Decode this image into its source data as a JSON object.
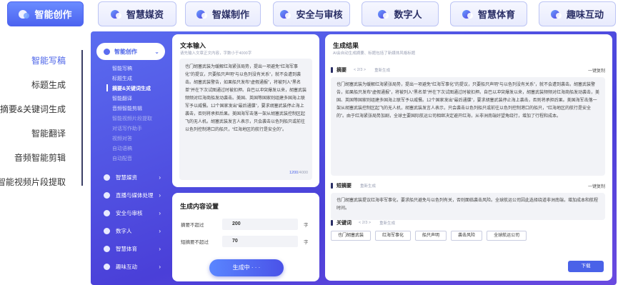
{
  "tabs": [
    {
      "label": "智能创作",
      "active": true
    },
    {
      "label": "智慧媒资"
    },
    {
      "label": "智媒制作"
    },
    {
      "label": "安全与审核"
    },
    {
      "label": "数字人"
    },
    {
      "label": "智慧体育"
    },
    {
      "label": "趣味互动"
    }
  ],
  "left_labels": [
    "智能写稿",
    "标题生成",
    "摘要&关键词生成",
    "智能翻译",
    "音频智能剪辑",
    "智能视频片段提取"
  ],
  "sidebar": {
    "head": "智能创作",
    "subs": [
      "智能写稿",
      "标题生成",
      "摘要&关键词生成",
      "智能翻译",
      "音频智能剪辑",
      "智能视频片段提取",
      "对话写作助手",
      "视频对答",
      "自动语稿",
      "自动配音"
    ],
    "items": [
      "智慧媒资",
      "直播与媒体处理",
      "安全与审核",
      "数字人",
      "智慧体育",
      "趣味互动"
    ]
  },
  "input_card": {
    "title": "文本输入",
    "hint": "请先输入文章正文内容，字数小于4000字",
    "text": "也门胡塞武装为缓解红海紧张局势，提出一项避免“红海军事化”的提议，只要船只声明“与以色列没有关系”，就不会遭到袭击。胡塞武装警告，如果船只发布“虚假通报”，将被列入“黑名单”并在下次试图通过时被扣押。自巴以冲突爆发以来，胡塞武装频频对红海商船发动袭击。美国、英国等国家则组建多国海上联军予以威慑。12个国家发出“最后通牒”，要求胡塞武装停止海上袭击，否则将承担后果。美国海军击落一架从胡塞武装控制区起飞的无人机。胡塞武装发言人表示，只会袭击以色列船只或前往以色列控制港口的船只，“红海地区的航行是安全的”。",
    "count_current": "1200",
    "count_max": "/4000"
  },
  "settings_card": {
    "title": "生成内容设置",
    "rows": [
      {
        "label": "摘要不超过",
        "value": "200",
        "unit": "字"
      },
      {
        "label": "短摘要不超过",
        "value": "70",
        "unit": "字"
      }
    ],
    "button": "生成中 · · ·"
  },
  "result_card": {
    "title": "生成结果",
    "hint": "AI会自动生成摘要、标题包括了新媒体风格标题",
    "summary": {
      "title": "摘要",
      "pager": "< 2/3 >",
      "regen": "重新生成",
      "copy": "一键复制",
      "text": "也门胡塞武装为缓解红海紧张局势，提出一项避免“红海军事化”的提议，只要船只声明“与以色列没有关系”，就不会遭到袭击。胡塞武装警告，如果船只发布“虚假通报”，将被列入“黑名单”并在下次试图通过时被扣押。自巴以冲突爆发以来，胡塞武装频频对红海商船发动袭击，美国、英国等国家则组建多国海上联军予以威慑。12个国家发出“最后通牒”，要求胡塞武装停止海上袭击，否则将承担后果。美国海军击落一架从胡塞武装控制区起飞的无人机，胡塞武装发言人表示，只会袭击以色列船只或前往以色列控制港口的船只，“红海地区的航行是安全的”。由于红海紧张局势加剧，全球主要国际航运公司相继决定避开红海，从非洲南端好望角绕行，增加了行程和成本。"
    },
    "short": {
      "title": "短摘要",
      "regen": "重新生成",
      "copy": "一键复制",
      "text": "也门胡塞武装提议红海非军事化，要求船只避免与以色列有关，否则面临袭击风险。全球航运公司因此选择绕道非洲南端，增加成本和航程时间。"
    },
    "keywords": {
      "title": "关键词",
      "pager": "< 2/3 >",
      "regen": "重新生成",
      "items": [
        "也门胡塞武装",
        "红海军事化",
        "船只声明",
        "袭击风险",
        "全球航运公司"
      ]
    },
    "download": "下载"
  }
}
